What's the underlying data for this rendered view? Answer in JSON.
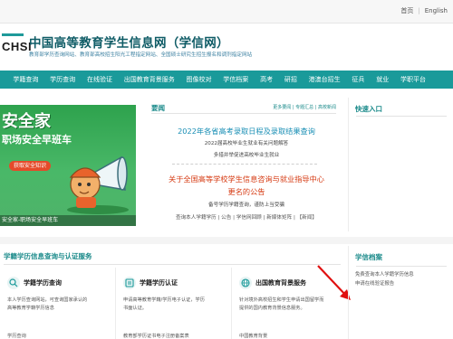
{
  "topbar": {
    "home": "首页",
    "sep": "|",
    "english": "English"
  },
  "header": {
    "logo": "CHSI",
    "title": "中国高等教育学生信息网（学信网）",
    "subtitle": "教育部学历查询网站、教育部高校招生阳光工程指定网站、全国硕士研究生招生报名和调剂指定网站"
  },
  "nav": [
    "学籍查询",
    "学历查询",
    "在线验证",
    "出国教育背景服务",
    "图像校对",
    "学信档案",
    "高考",
    "研招",
    "港澳台招生",
    "征兵",
    "就业",
    "学职平台"
  ],
  "banner": {
    "title": "安全家",
    "subtitle": "职场安全早班车",
    "button": "获取安全知识",
    "caption": "安全家-职场安全早班车"
  },
  "news": {
    "tab": "要闻",
    "links": "更多要闻  |  专题汇总  |  高校新闻",
    "headline1": "2022年各省高考录取日程及录取结果查询",
    "line1": "2022届高校毕业生就业有关问题解答",
    "line2": "多措并举促进高校毕业生就业",
    "headline2a": "关于全国高等学校学生信息咨询与就业指导中心",
    "headline2b": "更名的公告",
    "line3": "备号学历学籍查询，谨防上当受骗",
    "line4": "查询本人学籍学历 | 公告 | 学信网回顾 | 新媒体矩阵 | 【新闻】"
  },
  "quick": {
    "title": "快速入口"
  },
  "services": {
    "title": "学籍学历信息查询与认证服务",
    "cards": [
      {
        "title": "学籍学历查询",
        "desc1": "本人学历查询网站，可查询国家承认的",
        "desc2": "高等教育学籍学历信息",
        "foot": "学历查询"
      },
      {
        "title": "学籍学历认证",
        "desc1": "申请高等教育学籍/学历电子认证，学历",
        "desc2": "书面认证。",
        "foot": "教育部学历证书电子注册备案表"
      },
      {
        "title": "出国教育背景服务",
        "desc1": "针对境外高校招生和学生申请出国留学而",
        "desc2": "提供的国内教育背景信息服务。",
        "foot": "中国教育背景"
      }
    ]
  },
  "archive": {
    "title": "学信档案",
    "desc1": "免费查询本人学籍学历信息",
    "desc2": "申请在线验证报告"
  },
  "colors": {
    "teal": "#1a9a9a",
    "headline_blue": "#1a8fb5",
    "headline_red": "#d63a12",
    "banner_green": "#2ea24d"
  }
}
